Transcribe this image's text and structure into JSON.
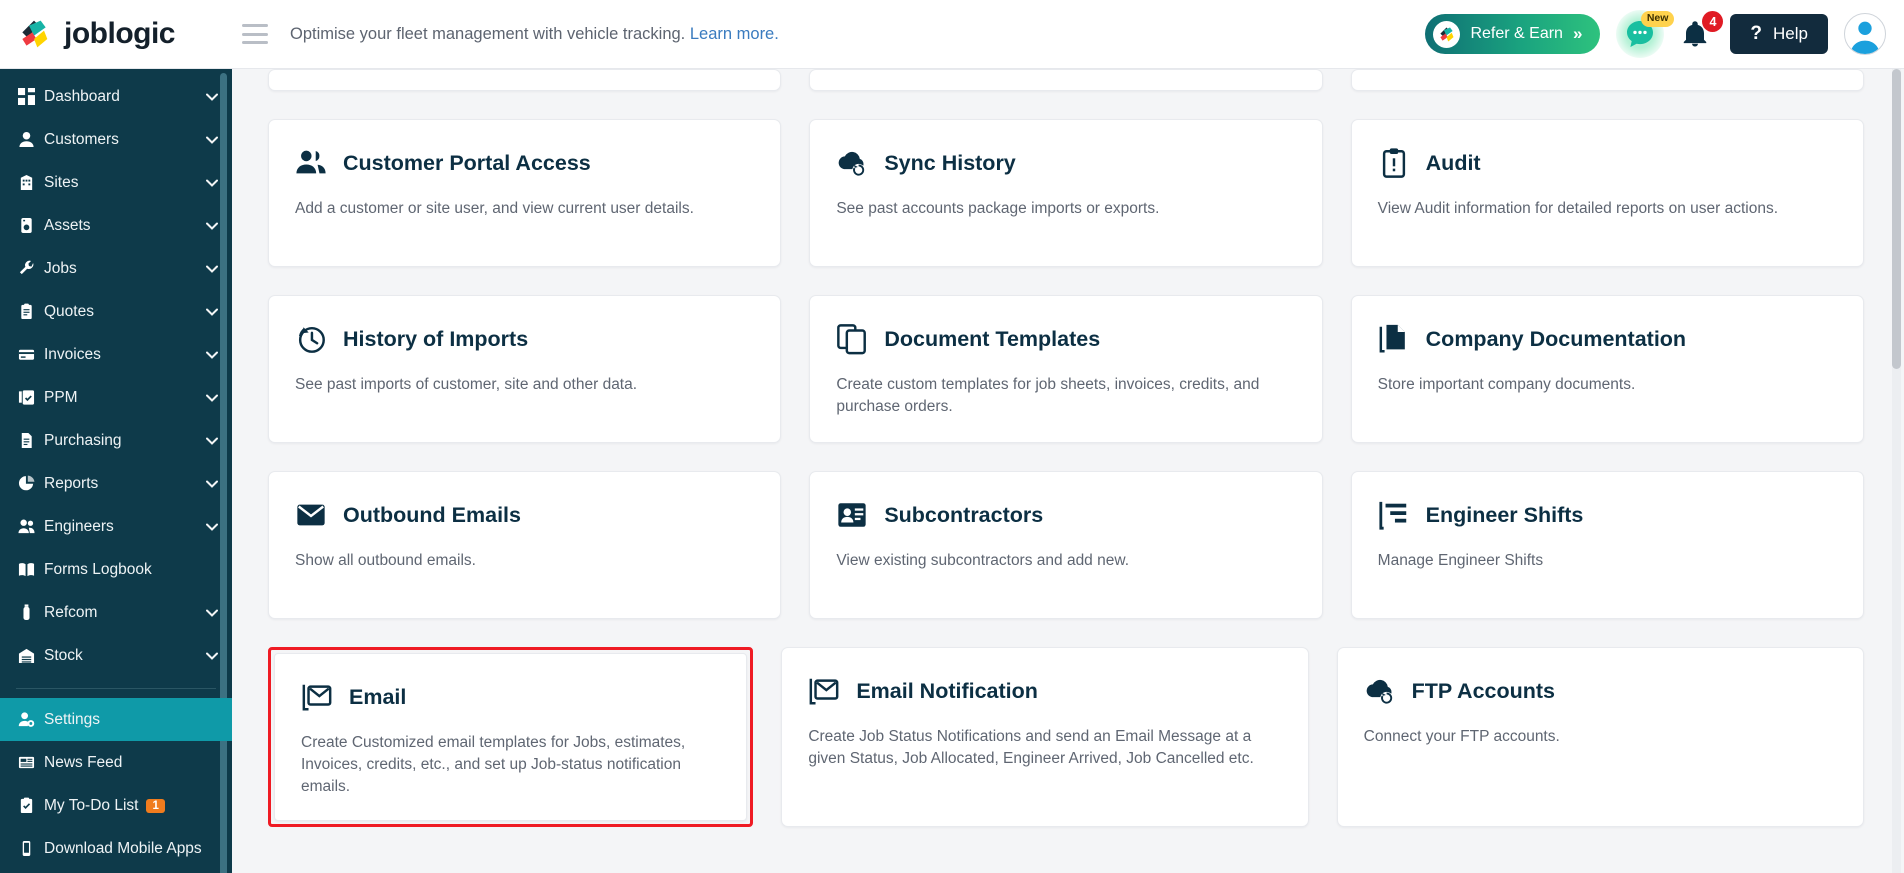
{
  "header": {
    "logo_text": "joblogic",
    "banner_text": "Optimise your fleet management with vehicle tracking.",
    "banner_link": "Learn more.",
    "refer_label": "Refer & Earn",
    "refer_chevron": "»",
    "chat_badge": "New",
    "bell_count": "4",
    "help_label": "Help",
    "help_icon_glyph": "?",
    "accent_green": "#2ec27e",
    "accent_dark": "#122b3d"
  },
  "sidebar": {
    "accent_active": "#0f9aa8",
    "background": "#0e3a4a",
    "items": [
      {
        "label": "Dashboard",
        "icon": "dashboard-icon",
        "chevron": true
      },
      {
        "label": "Customers",
        "icon": "user-icon",
        "chevron": true
      },
      {
        "label": "Sites",
        "icon": "building-icon",
        "chevron": true
      },
      {
        "label": "Assets",
        "icon": "asset-icon",
        "chevron": true
      },
      {
        "label": "Jobs",
        "icon": "wrench-icon",
        "chevron": true
      },
      {
        "label": "Quotes",
        "icon": "clipboard-icon",
        "chevron": true
      },
      {
        "label": "Invoices",
        "icon": "card-icon",
        "chevron": true
      },
      {
        "label": "PPM",
        "icon": "calendar-icon",
        "chevron": true
      },
      {
        "label": "Purchasing",
        "icon": "document-icon",
        "chevron": true
      },
      {
        "label": "Reports",
        "icon": "pie-chart-icon",
        "chevron": true
      },
      {
        "label": "Engineers",
        "icon": "users-icon",
        "chevron": true
      },
      {
        "label": "Forms Logbook",
        "icon": "book-icon",
        "chevron": false
      },
      {
        "label": "Refcom",
        "icon": "cylinder-icon",
        "chevron": true
      },
      {
        "label": "Stock",
        "icon": "warehouse-icon",
        "chevron": true
      }
    ],
    "bottom_items": [
      {
        "label": "Settings",
        "icon": "user-gear-icon",
        "active": true,
        "badge": null
      },
      {
        "label": "News Feed",
        "icon": "news-icon",
        "active": false,
        "badge": null
      },
      {
        "label": "My To-Do List",
        "icon": "checklist-icon",
        "active": false,
        "badge": "1"
      },
      {
        "label": "Download Mobile Apps",
        "icon": "mobile-icon",
        "active": false,
        "badge": null
      }
    ],
    "badge_color": "#f07c1e"
  },
  "main": {
    "highlight_color": "#ef1b24",
    "rows": [
      {
        "clipped": true,
        "cards": [
          {
            "title": "",
            "desc": ""
          },
          {
            "title": "",
            "desc": ""
          },
          {
            "title": "",
            "desc": ""
          }
        ]
      },
      {
        "clipped": false,
        "cards": [
          {
            "title": "Customer Portal Access",
            "icon": "users-icon",
            "desc": "Add a customer or site user, and view current user details."
          },
          {
            "title": "Sync History",
            "icon": "cloud-sync-icon",
            "desc": "See past accounts package imports or exports."
          },
          {
            "title": "Audit",
            "icon": "clipboard-alert-icon",
            "desc": "View Audit information for detailed reports on user actions."
          }
        ]
      },
      {
        "clipped": false,
        "cards": [
          {
            "title": "History of Imports",
            "icon": "clock-rotate-icon",
            "desc": "See past imports of customer, site and other data."
          },
          {
            "title": "Document Templates",
            "icon": "copy-documents-icon",
            "desc": "Create custom templates for job sheets, invoices, credits, and purchase orders."
          },
          {
            "title": "Company Documentation",
            "icon": "file-stack-icon",
            "desc": "Store important company documents."
          }
        ]
      },
      {
        "clipped": false,
        "cards": [
          {
            "title": "Outbound Emails",
            "icon": "envelope-solid-icon",
            "desc": "Show all outbound emails."
          },
          {
            "title": "Subcontractors",
            "icon": "id-card-icon",
            "desc": "View existing subcontractors and add new."
          },
          {
            "title": "Engineer Shifts",
            "icon": "gantt-chart-icon",
            "desc": "Manage Engineer Shifts"
          }
        ]
      },
      {
        "clipped": false,
        "cards": [
          {
            "title": "Email",
            "icon": "envelope-outline-icon",
            "highlighted": true,
            "desc": "Create Customized email templates for Jobs, estimates, Invoices, credits, etc., and set up Job-status notification emails."
          },
          {
            "title": "Email Notification",
            "icon": "envelope-outline-icon",
            "desc": "Create Job Status Notifications and send an Email Message at a given Status, Job Allocated, Engineer Arrived, Job Cancelled etc."
          },
          {
            "title": "FTP Accounts",
            "icon": "cloud-sync-icon",
            "desc": "Connect your FTP accounts."
          }
        ]
      }
    ]
  }
}
